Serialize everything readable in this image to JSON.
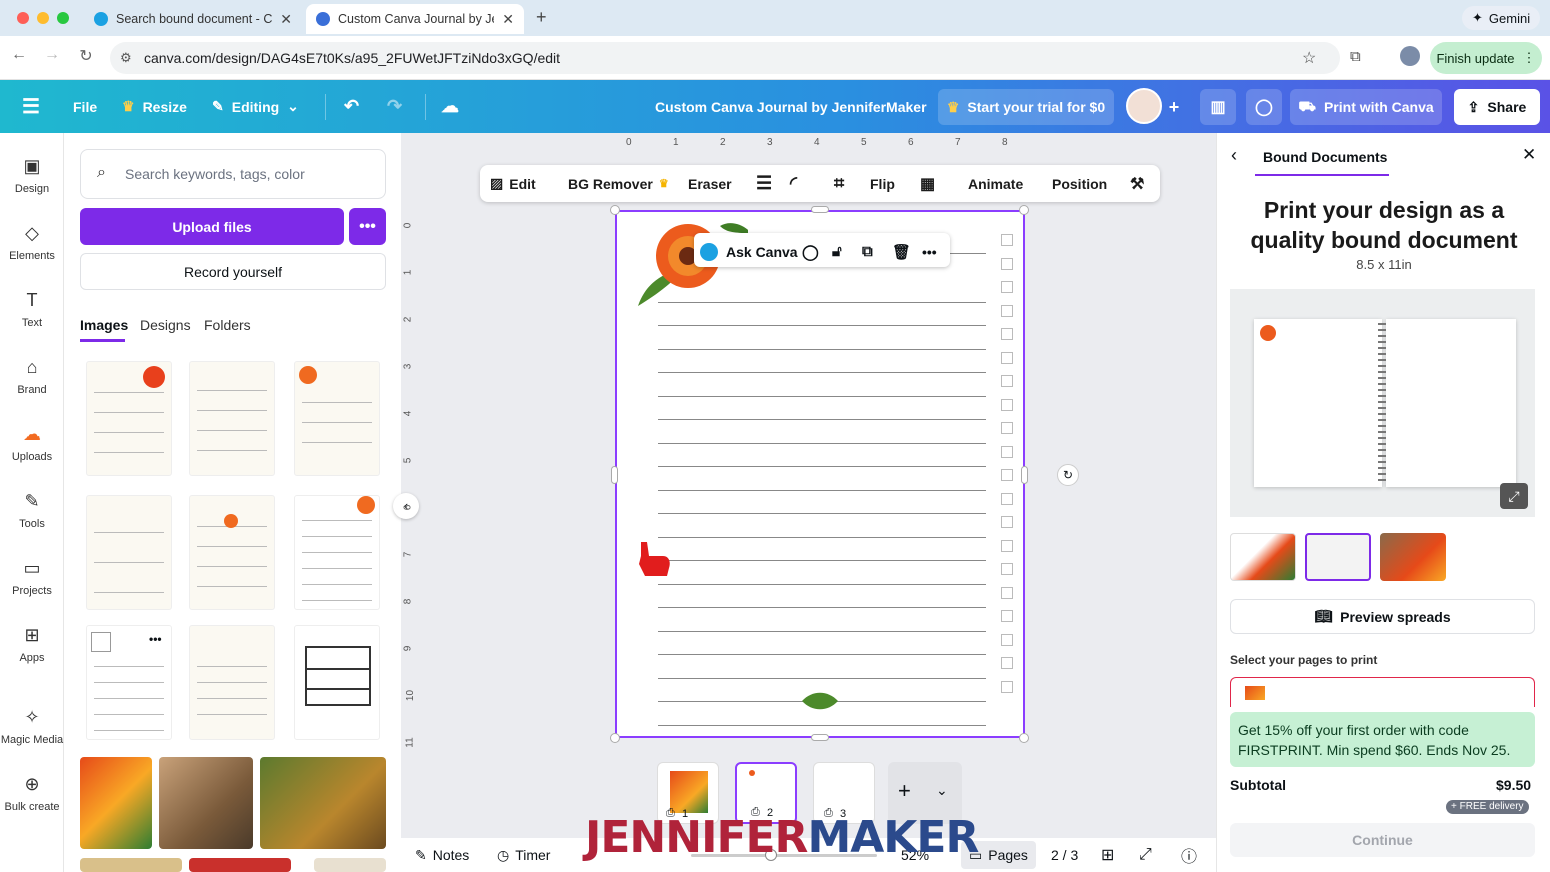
{
  "browser": {
    "tabs": [
      {
        "title": "Search bound document - Ca"
      },
      {
        "title": "Custom Canva Journal by Jen"
      }
    ],
    "new_tab": "+",
    "url": "canva.com/design/DAG4sE7t0Ks/a95_2FUWetJFTziNdo3xGQ/edit",
    "gemini": "Gemini",
    "finish_update": "Finish update"
  },
  "topbar": {
    "file": "File",
    "resize": "Resize",
    "editing": "Editing",
    "title": "Custom Canva Journal by JenniferMaker",
    "trial": "Start your trial for $0",
    "print": "Print with Canva",
    "share": "Share"
  },
  "rail": [
    {
      "label": "Design",
      "icon": "design-icon"
    },
    {
      "label": "Elements",
      "icon": "elements-icon"
    },
    {
      "label": "Text",
      "icon": "text-icon"
    },
    {
      "label": "Brand",
      "icon": "brand-icon"
    },
    {
      "label": "Uploads",
      "icon": "uploads-icon"
    },
    {
      "label": "Tools",
      "icon": "tools-icon"
    },
    {
      "label": "Projects",
      "icon": "projects-icon"
    },
    {
      "label": "Apps",
      "icon": "apps-icon"
    },
    {
      "label": "Magic Media",
      "icon": "magic-media-icon"
    },
    {
      "label": "Bulk create",
      "icon": "bulk-create-icon"
    }
  ],
  "panel": {
    "search_placeholder": "Search keywords, tags, color",
    "upload": "Upload files",
    "upload_more": "•••",
    "record": "Record yourself",
    "tabs": [
      "Images",
      "Designs",
      "Folders"
    ],
    "thumb_more": "•••"
  },
  "toolbar": {
    "edit": "Edit",
    "bg_remover": "BG Remover",
    "eraser": "Eraser",
    "flip": "Flip",
    "animate": "Animate",
    "position": "Position"
  },
  "ruler": {
    "top": [
      "0",
      "1",
      "2",
      "3",
      "4",
      "5",
      "6",
      "7",
      "8"
    ],
    "left": [
      "0",
      "1",
      "2",
      "3",
      "4",
      "5",
      "6",
      "7",
      "8",
      "9",
      "10",
      "11"
    ]
  },
  "context": {
    "ask_canva": "Ask Canva",
    "more": "•••"
  },
  "pages": {
    "numbers": [
      "1",
      "2",
      "3"
    ],
    "add": "+"
  },
  "bottombar": {
    "notes": "Notes",
    "timer": "Timer",
    "zoom": "52%",
    "pages": "Pages",
    "page_count": "2 / 3"
  },
  "right_panel": {
    "header": "Bound Documents",
    "heading": "Print your design as a quality bound document",
    "size": "8.5 x 11in",
    "preview_spreads": "Preview spreads",
    "select_pages": "Select your pages to print",
    "promo": "Get 15% off your first order with code FIRSTPRINT. Min spend $60. Ends Nov 25.",
    "subtotal_label": "Subtotal",
    "subtotal_value": "$9.50",
    "free_delivery": "+ FREE delivery",
    "continue": "Continue"
  },
  "watermark": {
    "part1": "JENNIFER",
    "part2": "MAKER"
  },
  "colors": {
    "accent_purple": "#7d2ae8",
    "selection": "#8b3dff",
    "promo_green": "#c6f0d4",
    "watermark_red": "#b0233a",
    "watermark_blue": "#2b4a8c"
  }
}
